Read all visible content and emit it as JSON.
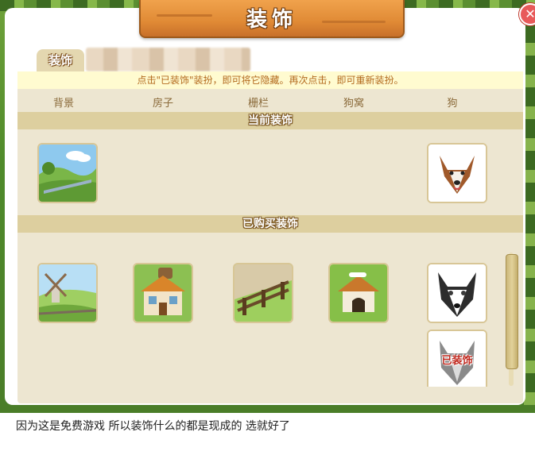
{
  "window": {
    "title": "装饰",
    "close_label": "✕"
  },
  "tab": {
    "label": "装饰"
  },
  "hint": "点击\"已装饰\"装扮，即可将它隐藏。再次点击，即可重新装扮。",
  "columns": [
    "背景",
    "房子",
    "栅栏",
    "狗窝",
    "狗"
  ],
  "sections": {
    "current": "当前装饰",
    "purchased": "已购买装饰"
  },
  "current_items": [
    {
      "slot": "背景",
      "icon": "landscape-background"
    },
    {
      "slot": "狗",
      "icon": "collie-dog"
    }
  ],
  "purchased_items": [
    {
      "slot": "背景",
      "icon": "windmill-background"
    },
    {
      "slot": "房子",
      "icon": "farmhouse"
    },
    {
      "slot": "栅栏",
      "icon": "wooden-fence"
    },
    {
      "slot": "狗窝",
      "icon": "doghouse"
    },
    {
      "slot": "狗",
      "icon": "husky-dog"
    },
    {
      "slot": "狗",
      "icon": "grey-dog",
      "status": "已装饰"
    }
  ],
  "caption": "因为这是免费游戏 所以装饰什么的都是现成的 选就好了",
  "colors": {
    "title_plank": "#e08a35",
    "content_bg": "#ede6d1",
    "section_bar": "#ddcf9f",
    "hint_bg": "#fffbd0",
    "hint_text": "#b36a1e",
    "close_button": "#e85a5a"
  }
}
